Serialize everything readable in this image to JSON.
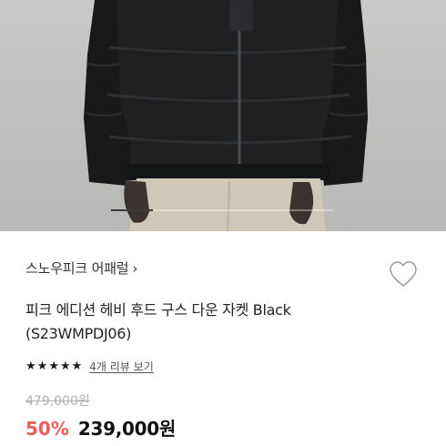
{
  "product_image": {
    "alt": "",
    "slide_progress": 0.19
  },
  "brand": {
    "name": "스노우피크 어패럴",
    "chevron": "›",
    "icon": "chevron-right-icon"
  },
  "wishlist": {
    "icon": "heart-outline-icon"
  },
  "title": {
    "line1": "피크 에디션 헤비 후드 구스 다운 자켓 Black",
    "line2": "(S23WMPDJ06)"
  },
  "rating": {
    "stars": 5,
    "star_glyph": "★",
    "review_label": "4개 리뷰 보기"
  },
  "price": {
    "original": "479,000원",
    "discount": "50%",
    "current": "239,000원",
    "discount_color": "#f25c5c"
  }
}
